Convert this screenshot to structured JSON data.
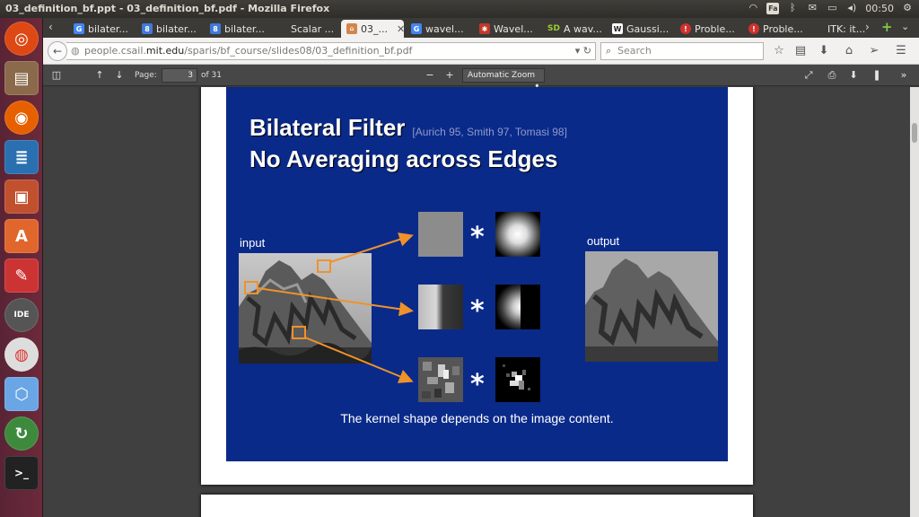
{
  "window": {
    "title": "03_definition_bf.ppt - 03_definition_bf.pdf - Mozilla Firefox"
  },
  "tray": {
    "fa": "Fa",
    "clock": "00:50"
  },
  "tabs": [
    {
      "label": "bilater...",
      "icon": "G",
      "color": "#4285f4"
    },
    {
      "label": "bilater...",
      "icon": "8",
      "color": "#3f7ad8"
    },
    {
      "label": "bilater...",
      "icon": "8",
      "color": "#3f7ad8"
    },
    {
      "label": "Scalar ...",
      "icon": "",
      "color": "#3b3a36"
    },
    {
      "label": "03_...",
      "icon": "pdf",
      "color": "#d4854a"
    },
    {
      "label": "wavel...",
      "icon": "G",
      "color": "#4285f4"
    },
    {
      "label": "Wavel...",
      "icon": "✱",
      "color": "#c0392b"
    },
    {
      "label": "A wav...",
      "icon": "SD",
      "color": "#6a9a2a"
    },
    {
      "label": "Gaussi...",
      "icon": "W",
      "color": "#222"
    },
    {
      "label": "Proble...",
      "icon": "!",
      "color": "#d0312d"
    },
    {
      "label": "Proble...",
      "icon": "!",
      "color": "#d0312d"
    },
    {
      "label": "ITK: it...",
      "icon": "",
      "color": "#3b3a36"
    }
  ],
  "url": {
    "prefix": "people.csail.",
    "domain": "mit.edu",
    "path": "/sparis/bf_course/slides08/03_definition_bf.pdf"
  },
  "search": {
    "placeholder": "Search"
  },
  "pdf": {
    "page_label": "Page:",
    "page_value": "3",
    "page_total": "of 31",
    "zoom": "Automatic Zoom"
  },
  "slide": {
    "title_line1": "Bilateral Filter",
    "citation": "[Aurich 95, Smith 97, Tomasi 98]",
    "title_line2": "No Averaging across Edges",
    "input_label": "input",
    "output_label": "output",
    "operator": "*",
    "caption": "The kernel shape depends on the image content."
  },
  "colors": {
    "slide_bg": "#0a2a8a",
    "arrow": "#f0922a"
  }
}
